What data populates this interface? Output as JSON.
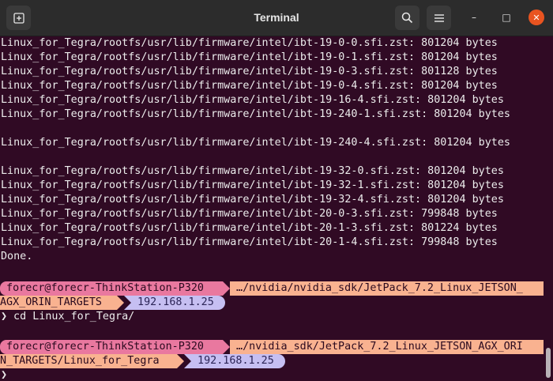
{
  "window": {
    "title": "Terminal"
  },
  "titlebar": {
    "new_tab_icon": "new-tab-icon",
    "search_icon": "search-icon",
    "menu_icon": "hamburger-menu-icon",
    "minimize_glyph": "–",
    "maximize_glyph": "□",
    "close_glyph": "✕"
  },
  "output_lines": [
    "Linux_for_Tegra/rootfs/usr/lib/firmware/intel/ibt-19-0-0.sfi.zst: 801204 bytes",
    "Linux_for_Tegra/rootfs/usr/lib/firmware/intel/ibt-19-0-1.sfi.zst: 801204 bytes",
    "Linux_for_Tegra/rootfs/usr/lib/firmware/intel/ibt-19-0-3.sfi.zst: 801128 bytes",
    "Linux_for_Tegra/rootfs/usr/lib/firmware/intel/ibt-19-0-4.sfi.zst: 801204 bytes",
    "Linux_for_Tegra/rootfs/usr/lib/firmware/intel/ibt-19-16-4.sfi.zst: 801204 bytes",
    "Linux_for_Tegra/rootfs/usr/lib/firmware/intel/ibt-19-240-1.sfi.zst: 801204 bytes",
    "",
    "Linux_for_Tegra/rootfs/usr/lib/firmware/intel/ibt-19-240-4.sfi.zst: 801204 bytes",
    "",
    "Linux_for_Tegra/rootfs/usr/lib/firmware/intel/ibt-19-32-0.sfi.zst: 801204 bytes",
    "Linux_for_Tegra/rootfs/usr/lib/firmware/intel/ibt-19-32-1.sfi.zst: 801204 bytes",
    "Linux_for_Tegra/rootfs/usr/lib/firmware/intel/ibt-19-32-4.sfi.zst: 801204 bytes",
    "Linux_for_Tegra/rootfs/usr/lib/firmware/intel/ibt-20-0-3.sfi.zst: 799848 bytes",
    "Linux_for_Tegra/rootfs/usr/lib/firmware/intel/ibt-20-1-3.sfi.zst: 801224 bytes",
    "Linux_for_Tegra/rootfs/usr/lib/firmware/intel/ibt-20-1-4.sfi.zst: 799848 bytes",
    "Done."
  ],
  "prompt1": {
    "user_host": " forecr@forecr-ThinkStation-P320",
    "path_part1": " …/nvidia/nvidia_sdk/JetPack_7.2_Linux_JETSON_",
    "path_part2": "AGX_ORIN_TARGETS",
    "ip": " 192.168.1.25",
    "prompt_char": "❯",
    "command": " cd Linux_for_Tegra/"
  },
  "prompt2": {
    "user_host": " forecr@forecr-ThinkStation-P320",
    "path_part1": " …/nvidia_sdk/JetPack_7.2_Linux_JETSON_AGX_ORI",
    "path_part2": "N_TARGETS/Linux_for_Tegra",
    "ip": " 192.168.1.25",
    "prompt_char": "❯"
  },
  "colors": {
    "terminal_bg": "#300a24",
    "user_segment": "#e9789f",
    "path_segment": "#f9b290",
    "ip_segment": "#c6bff2",
    "close_button": "#e95420"
  }
}
